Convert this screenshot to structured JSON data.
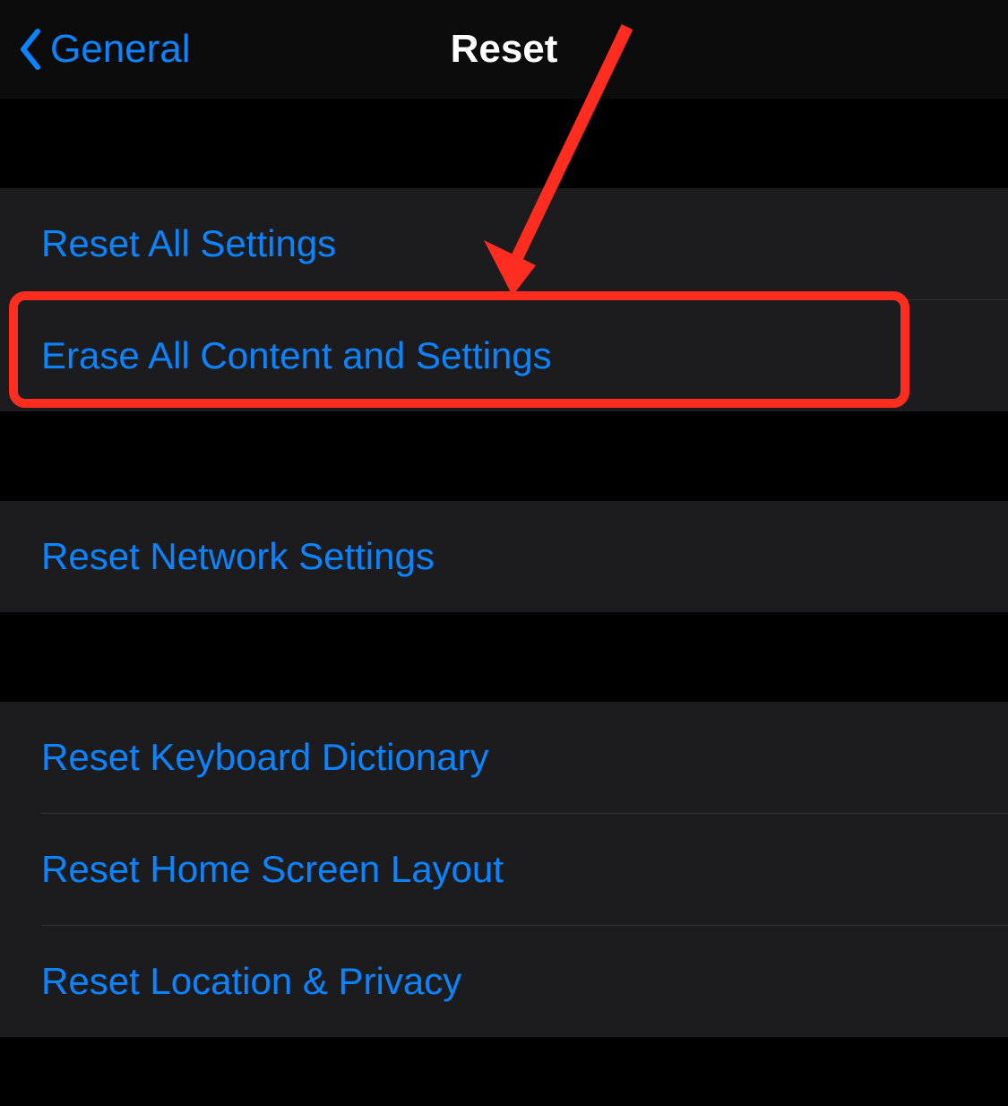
{
  "nav": {
    "back_label": "General",
    "title": "Reset"
  },
  "groups": [
    {
      "items": [
        {
          "label": "Reset All Settings"
        },
        {
          "label": "Erase All Content and Settings"
        }
      ]
    },
    {
      "items": [
        {
          "label": "Reset Network Settings"
        }
      ]
    },
    {
      "items": [
        {
          "label": "Reset Keyboard Dictionary"
        },
        {
          "label": "Reset Home Screen Layout"
        },
        {
          "label": "Reset Location & Privacy"
        }
      ]
    }
  ],
  "annotation": {
    "highlight_color": "#ff2d1f",
    "arrow_color": "#ff2d1f"
  }
}
